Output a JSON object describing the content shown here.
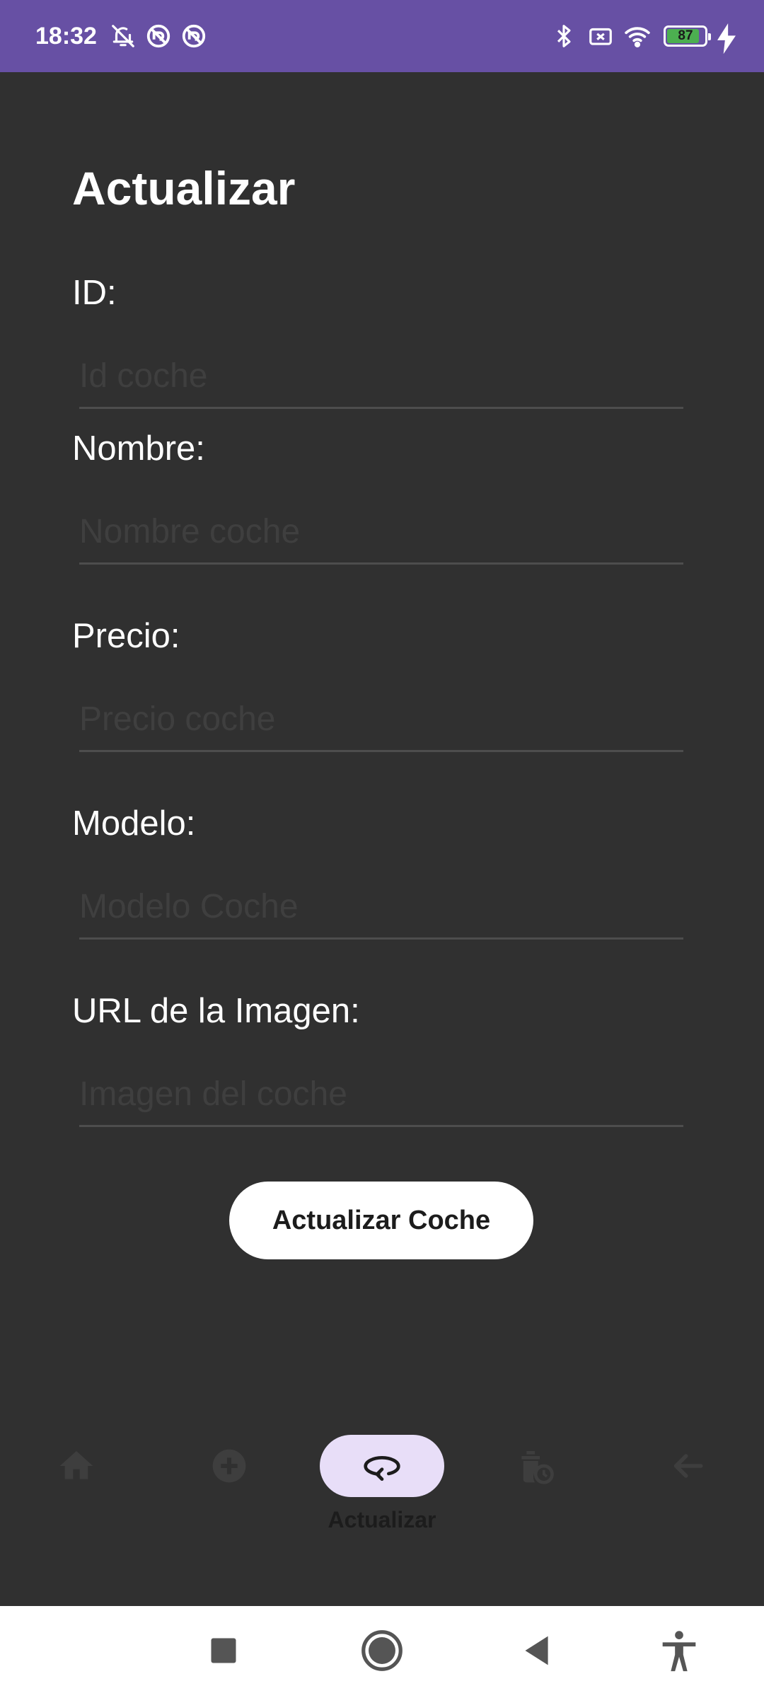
{
  "status_bar": {
    "time": "18:32",
    "battery_level": "87",
    "battery_fraction": 0.87,
    "icons_left": [
      "bell-off-icon",
      "sync-blocked-icon",
      "sync-blocked-icon"
    ],
    "icons_right": [
      "bluetooth-icon",
      "sim-blocked-icon",
      "wifi-icon",
      "battery-icon",
      "charging-icon"
    ],
    "color": "#6750a4"
  },
  "page": {
    "title": "Actualizar"
  },
  "form": {
    "fields": [
      {
        "label": "ID:",
        "placeholder": "Id coche",
        "value": ""
      },
      {
        "label": "Nombre:",
        "placeholder": "Nombre coche",
        "value": ""
      },
      {
        "label": "Precio:",
        "placeholder": "Precio coche",
        "value": ""
      },
      {
        "label": "Modelo:",
        "placeholder": "Modelo Coche",
        "value": ""
      },
      {
        "label": "URL de la Imagen:",
        "placeholder": "Imagen del coche",
        "value": ""
      }
    ],
    "submit_label": "Actualizar Coche"
  },
  "bottom_nav": {
    "items": [
      {
        "icon": "home-icon",
        "label": "",
        "active": false
      },
      {
        "icon": "add-circle-icon",
        "label": "",
        "active": false
      },
      {
        "icon": "update-icon",
        "label": "Actualizar",
        "active": true
      },
      {
        "icon": "delete-history-icon",
        "label": "",
        "active": false
      },
      {
        "icon": "arrow-back-icon",
        "label": "",
        "active": false
      }
    ],
    "active_pill_color": "#e8def8",
    "inactive_icon_color": "#3e3e3e"
  },
  "system_nav": {
    "buttons": [
      "recents-icon",
      "home-circle-icon",
      "back-triangle-icon",
      "accessibility-icon"
    ]
  }
}
